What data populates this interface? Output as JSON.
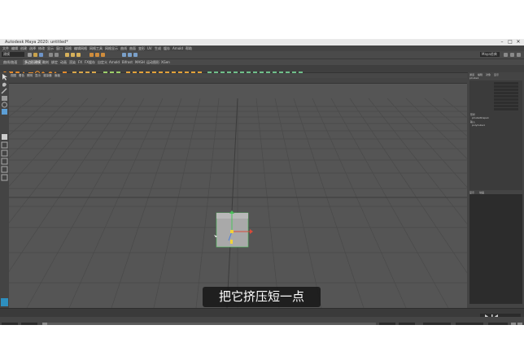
{
  "window": {
    "title": "Autodesk Maya 2020: untitled*",
    "minimize": "–",
    "maximize": "□",
    "close": "✕"
  },
  "menubar": {
    "items": [
      "文件",
      "编辑",
      "创建",
      "选择",
      "修改",
      "显示",
      "窗口",
      "网格",
      "编辑网格",
      "网格工具",
      "网格显示",
      "曲线",
      "曲面",
      "变形",
      "UV",
      "生成",
      "缓存",
      "Arnold",
      "帮助"
    ]
  },
  "statusline": {
    "mode": "建模",
    "workspace": "Maya经典"
  },
  "shelf": {
    "tabs": [
      "曲线/曲面",
      "多边形建模",
      "雕刻",
      "绑定",
      "动画",
      "渲染",
      "FX",
      "FX缓存",
      "自定义",
      "Arnold",
      "Bifrost",
      "MASH",
      "运动图形",
      "XGen"
    ],
    "active_tab": "多边形建模"
  },
  "panel_menu": {
    "items": [
      "视图",
      "着色",
      "照明",
      "显示",
      "渲染器",
      "面板"
    ]
  },
  "channel_box": {
    "tabs": [
      "通道",
      "编辑",
      "对象",
      "显示"
    ],
    "object": "pCube1",
    "shape_header": "形状",
    "shape_name": "pCubeShape1",
    "inputs_header": "输入",
    "input_name": "polyCube1"
  },
  "layer_panel": {
    "tabs": [
      "显示",
      "动画"
    ]
  },
  "subtitle": "把它挤压短一点",
  "colors": {
    "viewport_bg": "#555555",
    "cube": "#a9a9a9",
    "accent": "#5d9fd6",
    "manip_x": "#d94a3a",
    "manip_y": "#4ac35a",
    "manip_z": "#4a7fd9"
  }
}
